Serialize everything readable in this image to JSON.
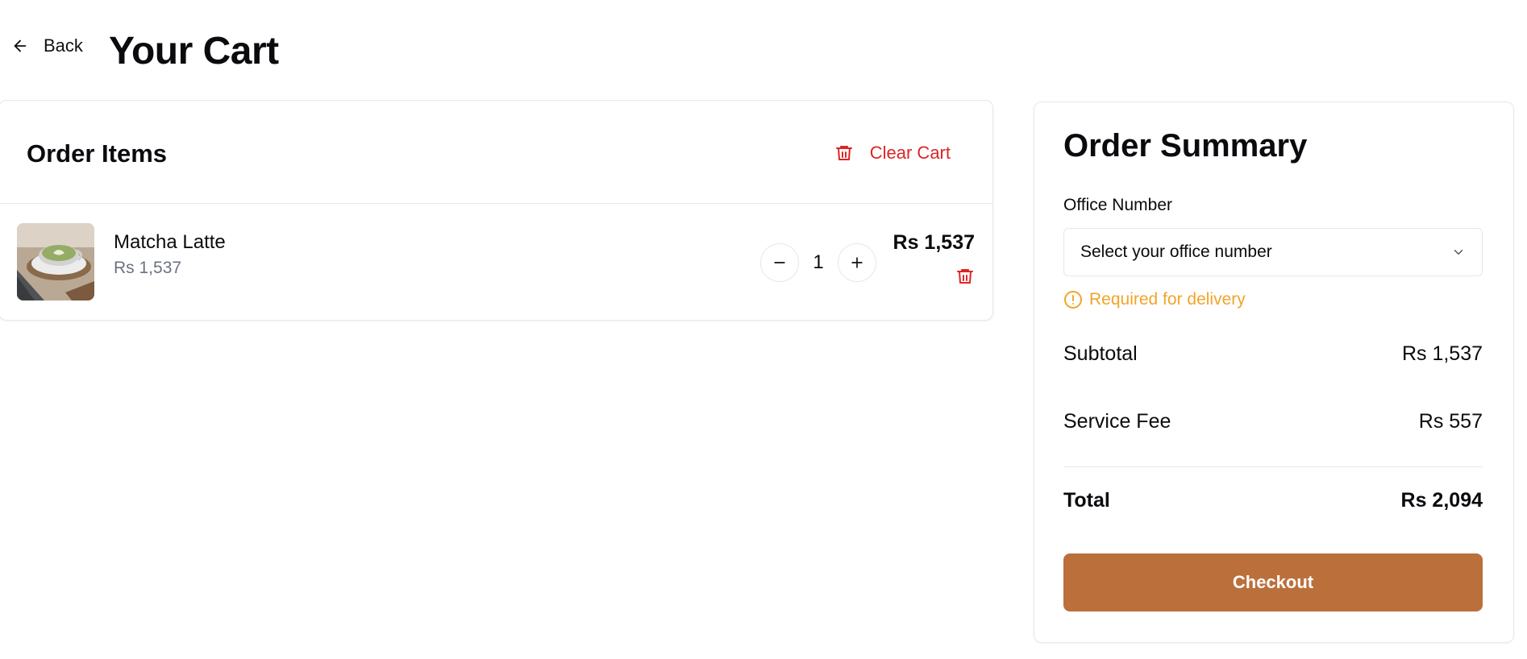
{
  "header": {
    "back_label": "Back",
    "title": "Your Cart"
  },
  "order_items": {
    "title": "Order Items",
    "clear_cart_label": "Clear Cart",
    "items": [
      {
        "name": "Matcha Latte",
        "unit_price": "Rs 1,537",
        "quantity": "1",
        "line_total": "Rs 1,537"
      }
    ]
  },
  "summary": {
    "title": "Order Summary",
    "office_label": "Office Number",
    "office_placeholder": "Select your office number",
    "office_warning": "Required for delivery",
    "subtotal_label": "Subtotal",
    "subtotal_value": "Rs 1,537",
    "service_fee_label": "Service Fee",
    "service_fee_value": "Rs 557",
    "total_label": "Total",
    "total_value": "Rs 2,094",
    "checkout_label": "Checkout"
  },
  "colors": {
    "danger": "#dc2626",
    "warning": "#f2a42a",
    "accent": "#bb703b",
    "muted_text": "#6b7280"
  },
  "icons": {
    "back": "arrow-left-icon",
    "clear_cart": "trash-icon",
    "decrement": "minus-icon",
    "increment": "plus-icon",
    "remove_item": "trash-icon",
    "select": "chevron-down-icon",
    "warning": "alert-circle-icon"
  }
}
